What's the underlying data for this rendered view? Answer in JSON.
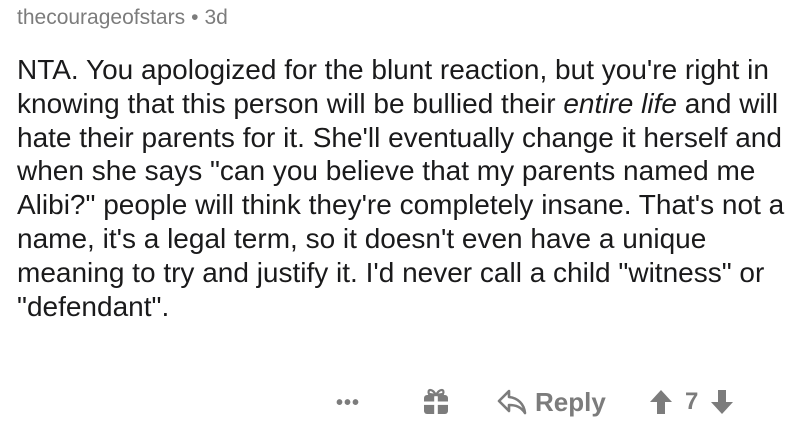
{
  "comment": {
    "username": "thecourageofstars",
    "separator": "•",
    "age": "3d",
    "body": {
      "part1": "NTA. You apologized for the blunt reaction, but you're right in knowing that this person will be bullied their ",
      "emphasis": "entire life",
      "part2": " and will hate their parents for it. She'll eventually change it herself and when she says \"can you believe that my parents named me Alibi?\" people will think they're completely insane. That's not a name, it's a legal term, so it doesn't even have a unique meaning to try and justify it. I'd never call a child \"witness\" or \"defendant\"."
    }
  },
  "actions": {
    "more_label": "•••",
    "reply_label": "Reply",
    "vote_count": "7"
  },
  "icons": {
    "more": "more-options-icon",
    "award": "award-gift-icon",
    "reply": "reply-arrow-icon",
    "upvote": "upvote-arrow-icon",
    "downvote": "downvote-arrow-icon"
  },
  "colors": {
    "text": "#1a1a1b",
    "meta": "#7c7c7c",
    "background": "#ffffff"
  }
}
